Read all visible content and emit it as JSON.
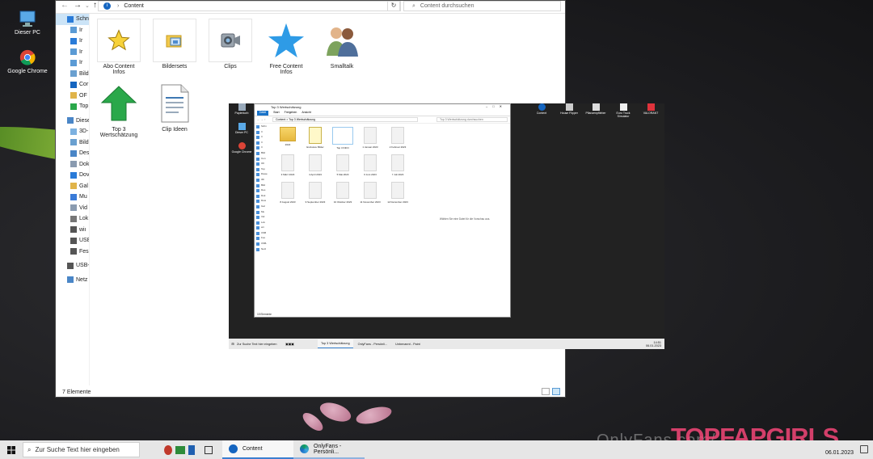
{
  "desktop": {
    "icons": [
      {
        "label": "Dieser PC"
      },
      {
        "label": "Google Chrome"
      }
    ]
  },
  "explorer": {
    "address_path": "Content",
    "search_placeholder": "Content durchsuchen",
    "nav_items": [
      {
        "label": "Schn"
      },
      {
        "label": "Ir"
      },
      {
        "label": "Ir"
      },
      {
        "label": "Ir"
      },
      {
        "label": "Ir"
      },
      {
        "label": "Bild"
      },
      {
        "label": "Cor"
      },
      {
        "label": "OF"
      },
      {
        "label": "Top"
      },
      {
        "label": "Dieser"
      },
      {
        "label": "3D-"
      },
      {
        "label": "Bild"
      },
      {
        "label": "Des"
      },
      {
        "label": "Dok"
      },
      {
        "label": "Dov"
      },
      {
        "label": "Gal"
      },
      {
        "label": "Mu"
      },
      {
        "label": "Vid"
      },
      {
        "label": "Lok"
      },
      {
        "label": "wiı"
      },
      {
        "label": "USE"
      },
      {
        "label": "Fes"
      },
      {
        "label": "USB-"
      },
      {
        "label": "Netz"
      }
    ],
    "files": [
      {
        "label": "Abo Content Infos",
        "icon": "star-icon"
      },
      {
        "label": "Bildersets",
        "icon": "image-folder-icon"
      },
      {
        "label": "Clips",
        "icon": "camera-icon"
      },
      {
        "label": "Free Content Infos",
        "icon": "blue-star-icon"
      },
      {
        "label": "Smalltalk",
        "icon": "people-icon"
      },
      {
        "label": "Top 3 Wertschätzung",
        "icon": "green-arrow-icon"
      },
      {
        "label": "Clip Ideen",
        "icon": "document-icon"
      }
    ],
    "status": "7 Elemente"
  },
  "inner_screenshot": {
    "desktop_icons": [
      {
        "label": "Papierkorb"
      },
      {
        "label": "Dieser PC"
      },
      {
        "label": "Google Chrome"
      }
    ],
    "right_desktop_icons": [
      {
        "label": "Content"
      },
      {
        "label": "House Flipper"
      },
      {
        "label": "Pflanzenpflieber"
      },
      {
        "label": "Euro Truck Simulator"
      },
      {
        "label": "VALORANT"
      }
    ],
    "window_title": "Top 3 Wertschätzung",
    "ribbon_tabs": [
      "Datei",
      "Start",
      "Freigeben",
      "Ansicht"
    ],
    "address": "Content > Top 3 Wertschätzung",
    "search_placeholder": "Top 3 Wertschätzung durchsuchen",
    "files": [
      "2022",
      "Exclusive Bilder",
      "Top 3 INFO",
      "1 Januar 2023",
      "2 Februar 2023",
      "3 März 2023",
      "4 April 2023",
      "5 Mai 2023",
      "6 Juni 2023",
      "7 Juli 2023",
      "8 August 2023",
      "9 September 2023",
      "10 Oktober 2023",
      "11 November 2023",
      "12 Dezember 2023"
    ],
    "preview_text": "Wählen Sie eine Datei für die Vorschau aus.",
    "status": "15 Elemente",
    "taskbar_search": "Zur Suche Text hier eingeben",
    "taskbar_apps": [
      "Top 3 Wertschätzung",
      "OnlyFans - Persönli...",
      "Unbenannt - Paint"
    ],
    "clock_time": "14:51",
    "clock_date": "06.01.2023"
  },
  "taskbar": {
    "search_placeholder": "Zur Suche Text hier eingeben",
    "apps": [
      {
        "label": "Content"
      },
      {
        "label": "OnlyFans - Persönli..."
      }
    ],
    "date": "06.01.2023"
  },
  "watermarks": {
    "onlyfans": "OnlyFans.com/",
    "site": "TOPFAPGIRLS"
  }
}
